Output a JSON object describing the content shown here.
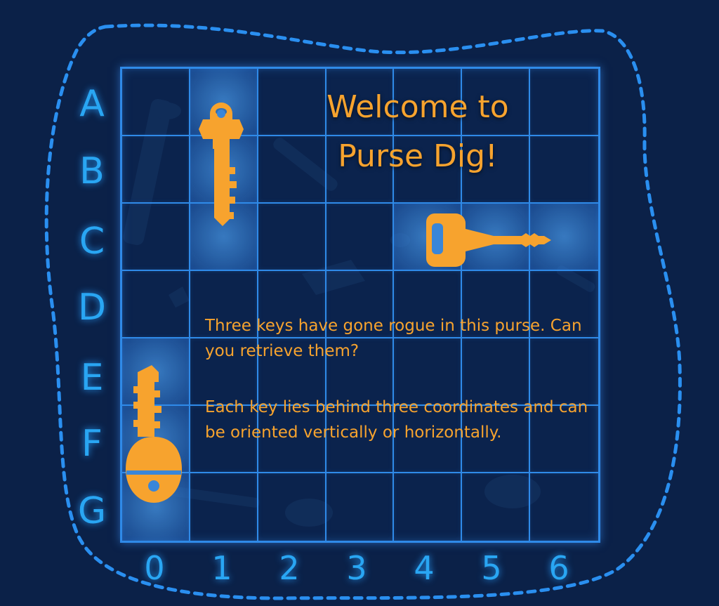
{
  "title": "Welcome to Purse Dig!",
  "instructions": [
    "Three keys have gone rogue in this purse. Can you retrieve them?",
    "Each key lies behind three coordinates and can be oriented vertically or horizontally."
  ],
  "grid": {
    "row_labels": [
      "A",
      "B",
      "C",
      "D",
      "E",
      "F",
      "G"
    ],
    "column_labels": [
      "0",
      "1",
      "2",
      "3",
      "4",
      "5",
      "6"
    ],
    "revealed_keys": [
      {
        "icon": "house-key-icon",
        "orientation": "vertical",
        "cells": [
          "A1",
          "B1",
          "C1"
        ]
      },
      {
        "icon": "car-key-icon",
        "orientation": "horizontal",
        "cells": [
          "C4",
          "C5",
          "C6"
        ]
      },
      {
        "icon": "house-key-icon",
        "orientation": "vertical",
        "cells": [
          "E0",
          "F0",
          "G0"
        ]
      }
    ]
  },
  "colors": {
    "background": "#0b2148",
    "grid_line": "#2f8ae8",
    "label": "#29a6f3",
    "text": "#f7a32e",
    "key": "#f7a32e",
    "revealed_cell": "#3a86d8"
  }
}
